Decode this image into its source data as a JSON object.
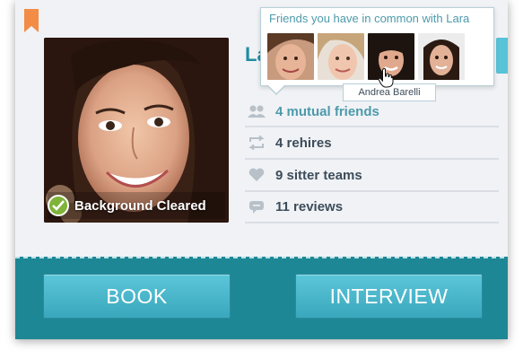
{
  "profile": {
    "name_partial": "La",
    "background_badge": "Background Cleared"
  },
  "stats": [
    {
      "icon": "people-icon",
      "label": "4 mutual friends"
    },
    {
      "icon": "repeat-icon",
      "label": "4 rehires"
    },
    {
      "icon": "heart-icon",
      "label": "9 sitter teams"
    },
    {
      "icon": "comment-icon",
      "label": "11 reviews"
    }
  ],
  "popover": {
    "title": "Friends you have in common with Lara",
    "hover_tooltip": "Andrea Barelli"
  },
  "actions": {
    "book_label": "BOOK",
    "interview_label": "INTERVIEW"
  },
  "colors": {
    "accent": "#1f8ca0",
    "bottom_bar": "#1e8795",
    "button": "#4fbbd0",
    "bookmark": "#f28c46",
    "badge_check": "#7fb33a"
  }
}
